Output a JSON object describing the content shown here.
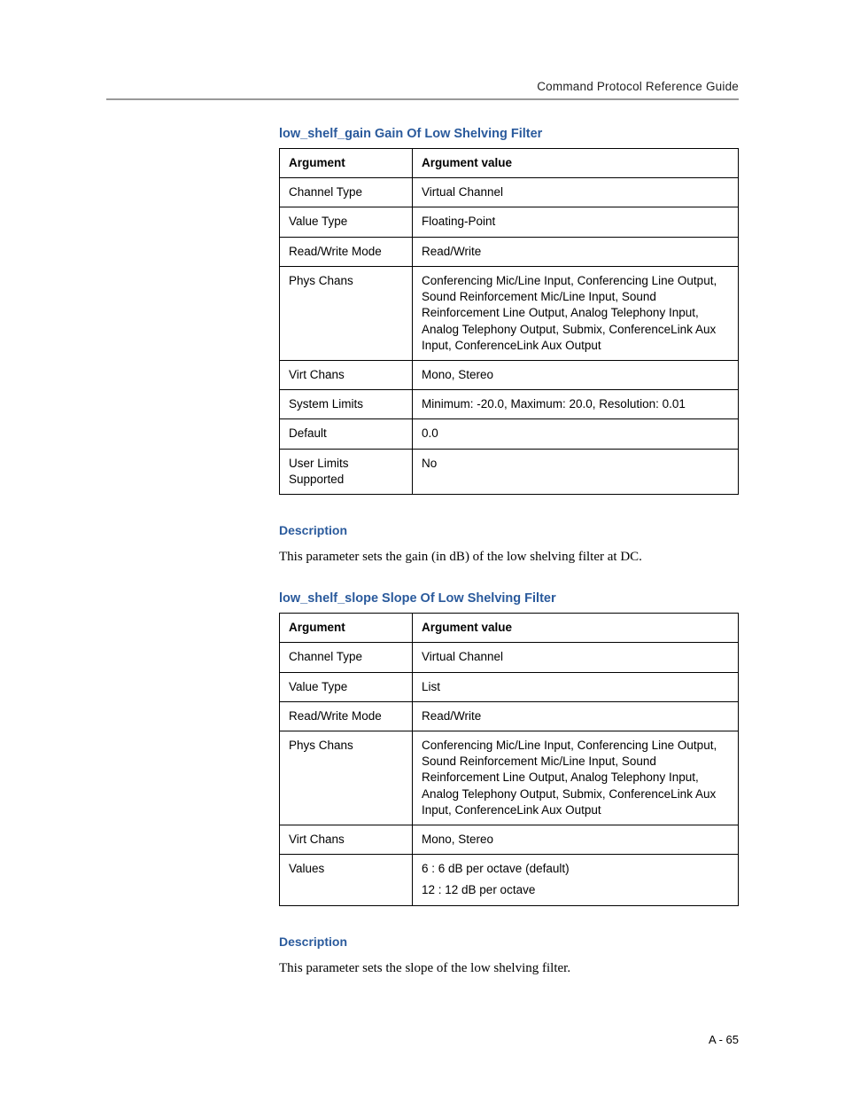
{
  "header": {
    "doc_title": "Command Protocol Reference Guide"
  },
  "section1": {
    "heading": "low_shelf_gain Gain Of Low Shelving Filter",
    "th_arg": "Argument",
    "th_val": "Argument value",
    "rows": [
      {
        "arg": "Channel Type",
        "val": "Virtual Channel"
      },
      {
        "arg": "Value Type",
        "val": "Floating-Point"
      },
      {
        "arg": "Read/Write Mode",
        "val": "Read/Write"
      },
      {
        "arg": "Phys Chans",
        "val": "Conferencing Mic/Line Input, Conferencing Line Output, Sound Reinforcement Mic/Line Input, Sound Reinforcement Line Output, Analog Telephony Input, Analog Telephony Output, Submix, ConferenceLink Aux Input, ConferenceLink Aux Output"
      },
      {
        "arg": "Virt Chans",
        "val": "Mono, Stereo"
      },
      {
        "arg": "System Limits",
        "val": "Minimum: -20.0, Maximum: 20.0, Resolution: 0.01"
      },
      {
        "arg": "Default",
        "val": "0.0"
      },
      {
        "arg": "User Limits Supported",
        "val": "No"
      }
    ],
    "desc_heading": "Description",
    "desc_text": "This parameter sets the gain (in dB) of the low shelving filter at DC."
  },
  "section2": {
    "heading": "low_shelf_slope Slope Of Low Shelving Filter",
    "th_arg": "Argument",
    "th_val": "Argument value",
    "rows": [
      {
        "arg": "Channel Type",
        "val": "Virtual Channel"
      },
      {
        "arg": "Value Type",
        "val": "List"
      },
      {
        "arg": "Read/Write Mode",
        "val": "Read/Write"
      },
      {
        "arg": "Phys Chans",
        "val": "Conferencing Mic/Line Input, Conferencing Line Output, Sound Reinforcement Mic/Line Input, Sound Reinforcement Line Output, Analog Telephony Input, Analog Telephony Output, Submix, ConferenceLink Aux Input, ConferenceLink Aux Output"
      },
      {
        "arg": "Virt Chans",
        "val": "Mono, Stereo"
      }
    ],
    "values_row": {
      "arg": "Values",
      "v1": "6 : 6 dB per octave (default)",
      "v2": "12 : 12 dB per octave"
    },
    "desc_heading": "Description",
    "desc_text": "This parameter sets the slope of the low shelving filter."
  },
  "page_number": "A - 65"
}
